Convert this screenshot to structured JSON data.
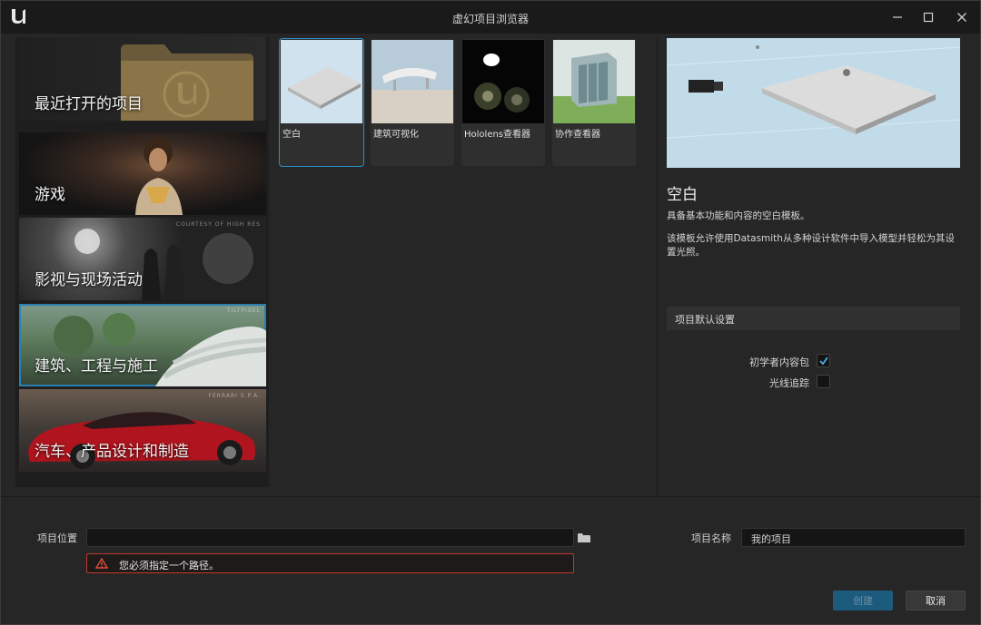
{
  "window": {
    "title": "虚幻项目浏览器",
    "logo": "unreal-engine-logo"
  },
  "categories": {
    "recent": "最近打开的项目",
    "items": [
      {
        "label": "游戏",
        "credit": "",
        "selected": false
      },
      {
        "label": "影视与现场活动",
        "credit": "COURTESY OF HIGH RES",
        "selected": false
      },
      {
        "label": "建筑、工程与施工",
        "credit": "TILTPIXEL",
        "selected": true
      },
      {
        "label": "汽车、产品设计和制造",
        "credit": "FERRARI S.P.A.",
        "selected": false
      }
    ]
  },
  "templates": [
    {
      "label": "空白",
      "selected": true
    },
    {
      "label": "建筑可视化",
      "selected": false
    },
    {
      "label": "Hololens查看器",
      "selected": false
    },
    {
      "label": "协作查看器",
      "selected": false
    }
  ],
  "details": {
    "title": "空白",
    "description1": "具备基本功能和内容的空白模板。",
    "description2": "该模板允许使用Datasmith从多种设计软件中导入模型并轻松为其设置光照。",
    "defaults_header": "项目默认设置",
    "options": [
      {
        "label": "初学者内容包",
        "checked": true
      },
      {
        "label": "光线追踪",
        "checked": false
      }
    ]
  },
  "bottom": {
    "location_label": "项目位置",
    "location_value": "",
    "error_message": "您必须指定一个路径。",
    "name_label": "项目名称",
    "name_value": "我的项目",
    "create_label": "创建",
    "cancel_label": "取消"
  },
  "colors": {
    "accent": "#2a8fc7",
    "error": "#c0392b",
    "create_button": "#1c5a7e"
  }
}
